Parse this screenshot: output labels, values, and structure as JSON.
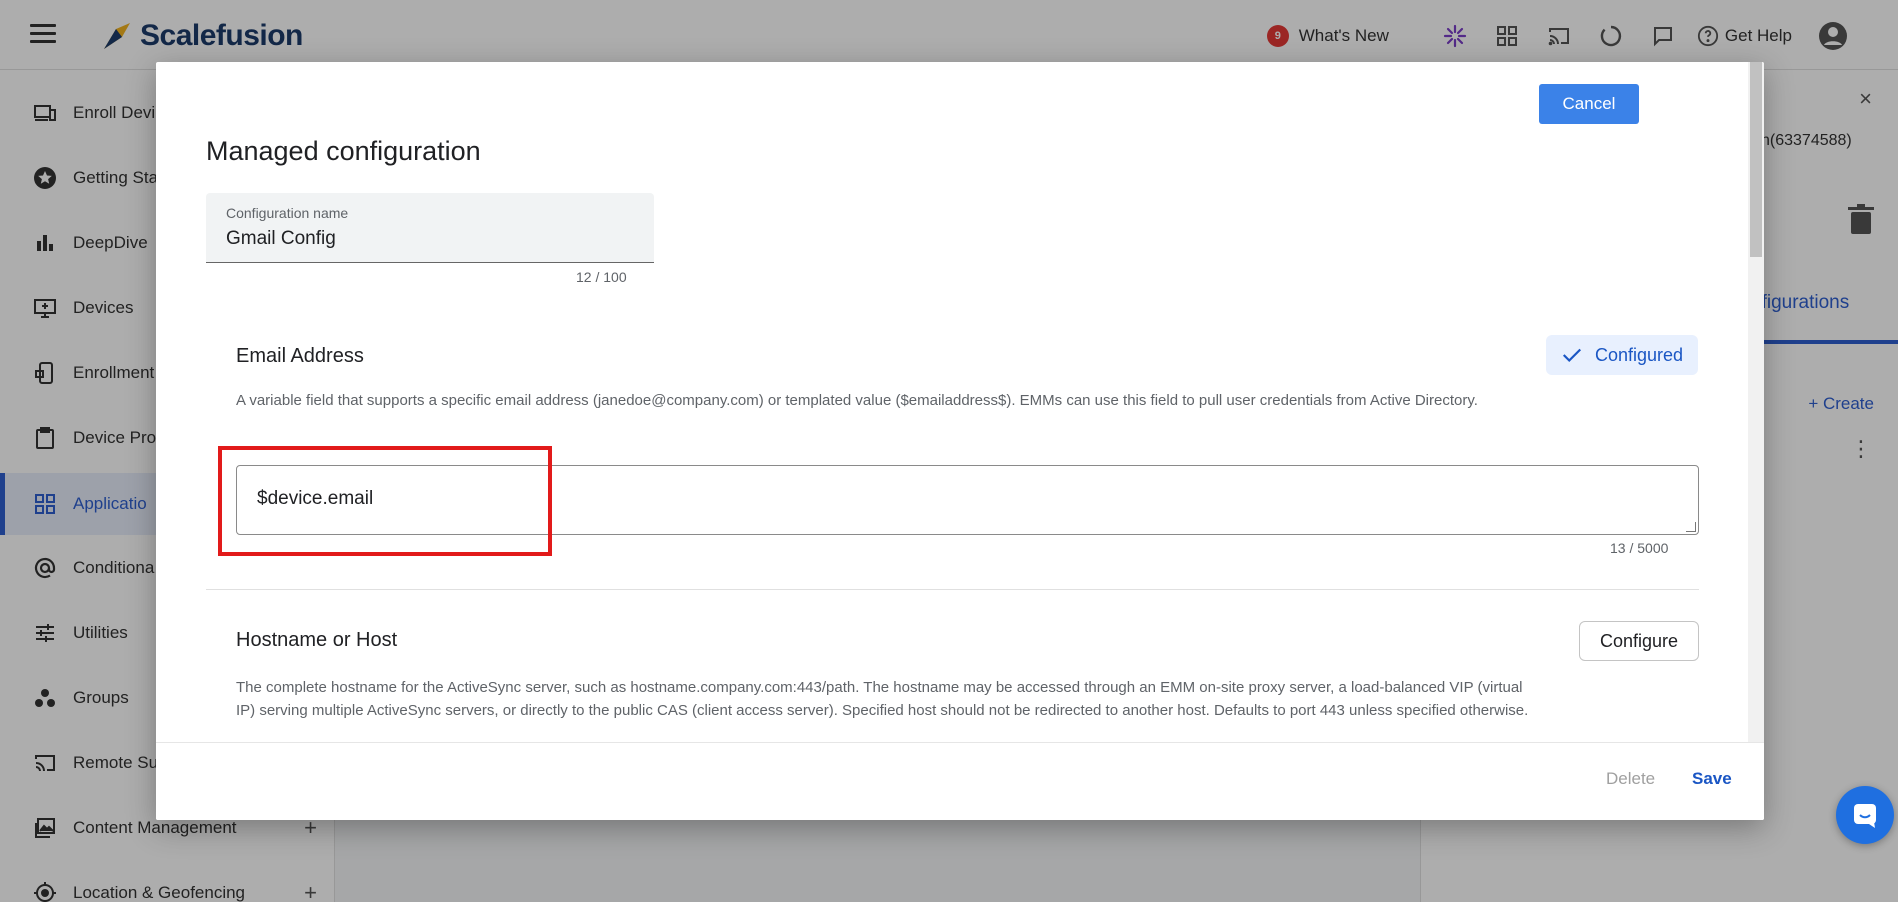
{
  "app": {
    "brand": "Scalefusion",
    "whats_new": {
      "label": "What's New",
      "count": "9"
    },
    "get_help": "Get Help"
  },
  "sidebar": {
    "items": [
      {
        "label": "Enroll Devi",
        "icon": "devices-icon"
      },
      {
        "label": "Getting Sta",
        "icon": "star-icon"
      },
      {
        "label": "DeepDive",
        "icon": "bar-chart-icon"
      },
      {
        "label": "Devices",
        "icon": "monitor-icon"
      },
      {
        "label": "Enrollment",
        "icon": "phone-lock-icon"
      },
      {
        "label": "Device Prof",
        "icon": "clipboard-icon"
      },
      {
        "label": "Applicatio",
        "icon": "grid-icon",
        "active": true
      },
      {
        "label": "Conditiona",
        "icon": "at-icon"
      },
      {
        "label": "Utilities",
        "icon": "sliders-icon"
      },
      {
        "label": "Groups",
        "icon": "groups-icon"
      },
      {
        "label": "Remote Su",
        "icon": "cast-icon"
      },
      {
        "label": "Content Management",
        "icon": "image-icon"
      },
      {
        "label": "Location & Geofencing",
        "icon": "location-icon"
      }
    ],
    "expand_symbol": "+"
  },
  "right_panel": {
    "close": "×",
    "id_text": "n(63374588)",
    "tab_label": "nfigurations",
    "create_label": "+ Create",
    "more": "⋮"
  },
  "dialog": {
    "cancel_label": "Cancel",
    "title": "Managed configuration",
    "config_name": {
      "label": "Configuration name",
      "value": "Gmail Config",
      "counter": "12 / 100"
    },
    "email_section": {
      "title": "Email Address",
      "status_label": "Configured",
      "description": "A variable field that supports a specific email address (janedoe@company.com) or templated value ($emailaddress$). EMMs can use this field to pull user credentials from Active Directory.",
      "value": "$device.email",
      "counter": "13 / 5000"
    },
    "host_section": {
      "title": "Hostname or Host",
      "configure_label": "Configure",
      "description": "The complete hostname for the ActiveSync server, such as hostname.company.com:443/path. The hostname may be accessed through an EMM on-site proxy server, a load-balanced VIP (virtual IP) serving multiple ActiveSync servers, or directly to the public CAS (client access server). Specified host should not be redirected to another host. Defaults to port 443 unless specified otherwise."
    },
    "footer": {
      "delete_label": "Delete",
      "save_label": "Save"
    }
  },
  "colors": {
    "accent": "#2f5fd0",
    "primary_button": "#3b82e8",
    "highlight_border": "#e21a1a",
    "badge": "#e53935"
  }
}
